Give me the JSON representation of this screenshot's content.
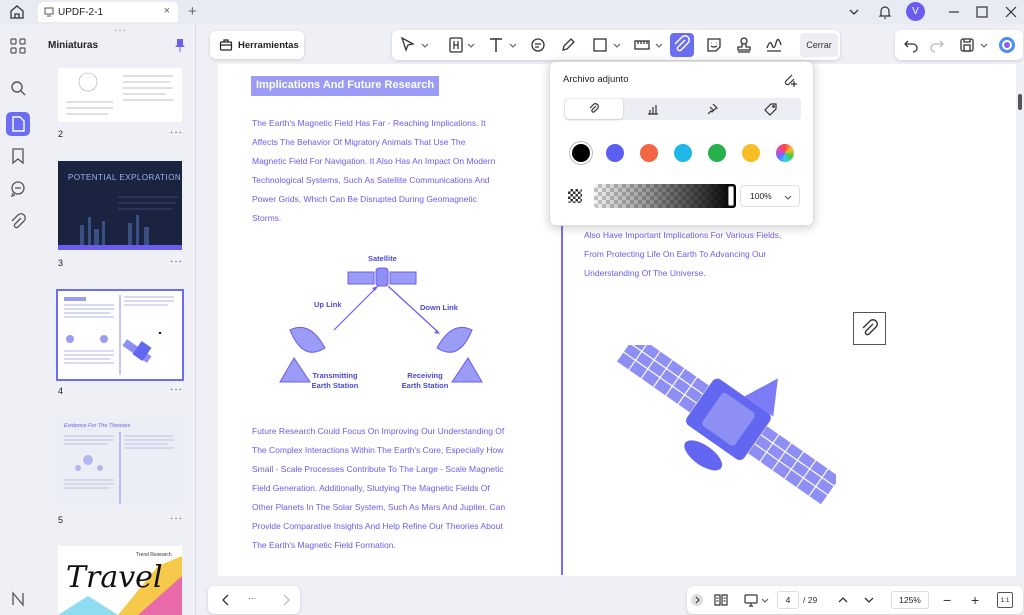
{
  "tab": {
    "title": "UPDF-2-1",
    "close": "×"
  },
  "sidebar": {
    "title": "Miniaturas"
  },
  "thumbs": [
    {
      "num": "2",
      "dots": "···"
    },
    {
      "num": "3",
      "dots": "···",
      "text": "POTENTIAL EXPLORATION"
    },
    {
      "num": "4",
      "dots": "···"
    },
    {
      "num": "5",
      "dots": "···",
      "text": "Evidence For The Theories"
    },
    {
      "text": "Travel",
      "sub": "Trend Research"
    }
  ],
  "toolbar": {
    "tools_label": "Herramientas",
    "close_label": "Cerrar"
  },
  "popup": {
    "title": "Archivo adjunto",
    "opacity": "100%",
    "colors": [
      "#000000",
      "#5b5ff0",
      "#f26545",
      "#1fb6e8",
      "#27b04b",
      "#f7bd25",
      "#e040a0"
    ]
  },
  "document": {
    "heading": "Implications And Future Research",
    "para1": [
      "The Earth's Magnetic Field Has Far - Reaching Implications. It",
      "Affects The Behavior Of Migratory Animals That Use The",
      "Magnetic Field For Navigation. It Also Has An Impact On Modern",
      "Technological Systems, Such As Satellite Communications And",
      "Power Grids, Which Can Be Disrupted During Geomagnetic",
      "Storms."
    ],
    "diagram": {
      "satellite": "Satellite",
      "uplink": "Up Link",
      "downlink": "Down Link",
      "transmit1": "Transmitting",
      "transmit2": "Earth Station",
      "receive1": "Receiving",
      "receive2": "Earth Station"
    },
    "para2": [
      "Future Research Could Focus On Improving Our Understanding Of",
      "The Complex Interactions Within The Earth's Core, Especially How",
      "Small - Scale Processes Contribute To The Large - Scale Magnetic",
      "Field Generation. Additionally, Studying The Magnetic Fields Of",
      "Other Planets In The Solar System, Such As Mars And Jupiter, Can",
      "Provide Comparative Insights And Help Refine Our Theories About",
      "The Earth's Magnetic Field Formation."
    ],
    "right_para": [
      "Also Have Important Implications For Various Fields,",
      "From Protecting Life On Earth To Advancing Our",
      "Understanding Of The Universe."
    ]
  },
  "bottom": {
    "nav_dots": "···",
    "page_current": "4",
    "page_total": "/ 29",
    "zoom": "125%",
    "minus": "−",
    "plus": "+",
    "fit": "1:1"
  },
  "avatar": "V"
}
